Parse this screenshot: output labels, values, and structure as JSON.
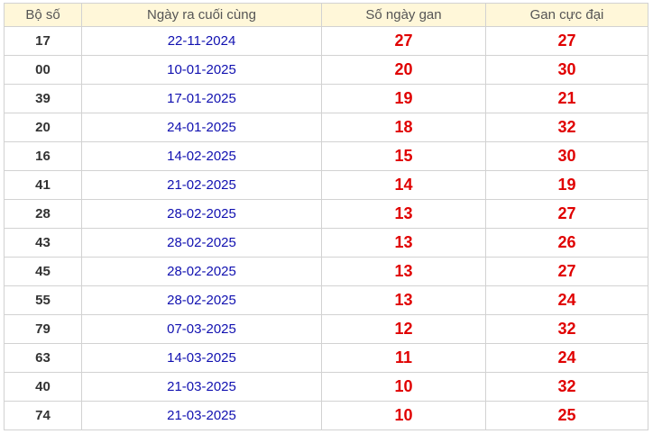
{
  "table": {
    "headers": {
      "number": "Bộ số",
      "last_date": "Ngày ra cuối cùng",
      "days_gap": "Số ngày gan",
      "max_gap": "Gan cực đại"
    },
    "rows": [
      {
        "number": "17",
        "last_date": "22-11-2024",
        "days_gap": "27",
        "max_gap": "27"
      },
      {
        "number": "00",
        "last_date": "10-01-2025",
        "days_gap": "20",
        "max_gap": "30"
      },
      {
        "number": "39",
        "last_date": "17-01-2025",
        "days_gap": "19",
        "max_gap": "21"
      },
      {
        "number": "20",
        "last_date": "24-01-2025",
        "days_gap": "18",
        "max_gap": "32"
      },
      {
        "number": "16",
        "last_date": "14-02-2025",
        "days_gap": "15",
        "max_gap": "30"
      },
      {
        "number": "41",
        "last_date": "21-02-2025",
        "days_gap": "14",
        "max_gap": "19"
      },
      {
        "number": "28",
        "last_date": "28-02-2025",
        "days_gap": "13",
        "max_gap": "27"
      },
      {
        "number": "43",
        "last_date": "28-02-2025",
        "days_gap": "13",
        "max_gap": "26"
      },
      {
        "number": "45",
        "last_date": "28-02-2025",
        "days_gap": "13",
        "max_gap": "27"
      },
      {
        "number": "55",
        "last_date": "28-02-2025",
        "days_gap": "13",
        "max_gap": "24"
      },
      {
        "number": "79",
        "last_date": "07-03-2025",
        "days_gap": "12",
        "max_gap": "32"
      },
      {
        "number": "63",
        "last_date": "14-03-2025",
        "days_gap": "11",
        "max_gap": "24"
      },
      {
        "number": "40",
        "last_date": "21-03-2025",
        "days_gap": "10",
        "max_gap": "32"
      },
      {
        "number": "74",
        "last_date": "21-03-2025",
        "days_gap": "10",
        "max_gap": "25"
      }
    ]
  },
  "colors": {
    "header_bg": "#fff7d9",
    "header_text": "#555555",
    "number_text": "#333333",
    "date_text": "#1010b0",
    "gap_text": "#e00000",
    "border": "#d2d2d2"
  }
}
